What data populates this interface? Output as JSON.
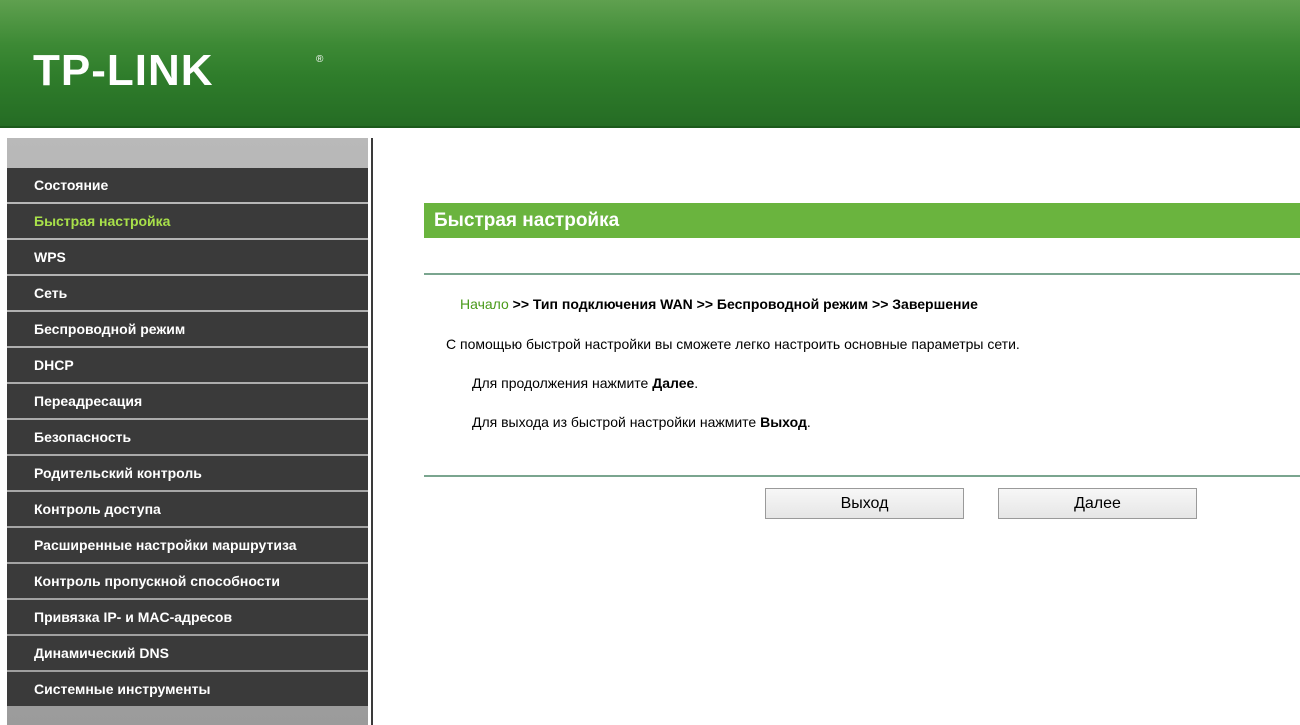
{
  "header": {
    "logo_text": "TP-LINK",
    "logo_reg": "®"
  },
  "sidebar": {
    "items": [
      {
        "label": "Состояние"
      },
      {
        "label": "Быстрая настройка",
        "active": true
      },
      {
        "label": "WPS"
      },
      {
        "label": "Сеть"
      },
      {
        "label": "Беспроводной режим"
      },
      {
        "label": "DHCP"
      },
      {
        "label": "Переадресация"
      },
      {
        "label": "Безопасность"
      },
      {
        "label": "Родительский контроль"
      },
      {
        "label": "Контроль доступа"
      },
      {
        "label": "Расширенные настройки маршрутиза"
      },
      {
        "label": "Контроль пропускной способности"
      },
      {
        "label": "Привязка IP- и MAC-адресов"
      },
      {
        "label": "Динамический DNS"
      },
      {
        "label": "Системные инструменты"
      }
    ]
  },
  "main": {
    "title": "Быстрая настройка",
    "breadcrumb": {
      "current": "Начало",
      "rest": " >> Тип подключения WAN >> Беспроводной режим >> Завершение"
    },
    "description": "С помощью быстрой настройки вы сможете легко настроить основные параметры сети.",
    "continue_prefix": "Для продолжения нажмите ",
    "continue_bold": "Далее",
    "continue_suffix": ".",
    "exit_prefix": "Для выхода из быстрой настройки нажмите ",
    "exit_bold": "Выход",
    "exit_suffix": ".",
    "buttons": {
      "exit_label": "Выход",
      "next_label": "Далее"
    }
  },
  "colors": {
    "header_green": "#2f7d2b",
    "title_bar_green": "#6ab43e",
    "menu_bg": "#3a3a3a",
    "menu_active_text": "#a8e04a"
  }
}
